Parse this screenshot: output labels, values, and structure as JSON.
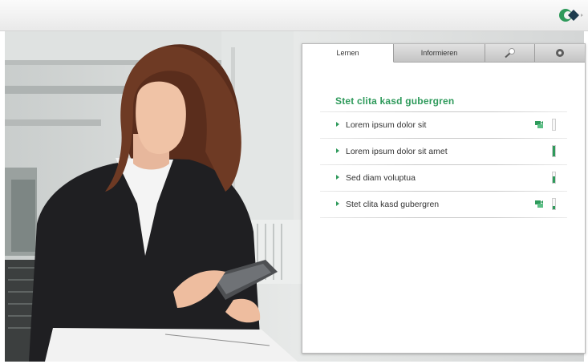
{
  "tabs": [
    {
      "label": "Lernen",
      "active": true
    },
    {
      "label": "Informieren",
      "active": false
    },
    {
      "icon": "search-icon",
      "active": false
    },
    {
      "icon": "settings-icon",
      "active": false
    }
  ],
  "section_title": "Stet clita kasd gubergren",
  "items": [
    {
      "label": "Lorem ipsum dolor sit",
      "refresh_icon": true,
      "progress": 0.0
    },
    {
      "label": "Lorem ipsum dolor sit amet",
      "refresh_icon": false,
      "progress": 1.0
    },
    {
      "label": "Sed diam voluptua",
      "refresh_icon": false,
      "progress": 0.65
    },
    {
      "label": "Stet clita kasd gubergren",
      "refresh_icon": true,
      "progress": 0.3
    }
  ],
  "colors": {
    "accent": "#2e9a5b",
    "logo_green": "#2e9a5b",
    "logo_dark": "#1d3c4e"
  }
}
